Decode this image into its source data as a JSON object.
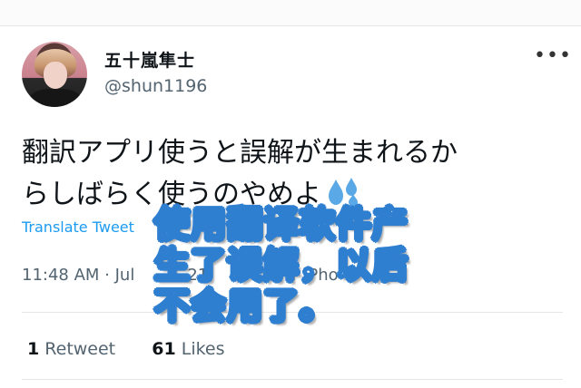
{
  "profile": {
    "display_name": "五十嵐隼士",
    "handle": "@shun1196"
  },
  "header": {
    "more_icon": "more-horizontal-icon",
    "more_glyph": "•••"
  },
  "tweet": {
    "text_line_1": "翻訳アプリ使うと誤解が生まれるか",
    "text_line_2": "らしばらく使うのやめよ",
    "emoji": "sweat-droplets-icon",
    "translate_label": "Translate Tweet",
    "timestamp": "11:48 AM · Jul",
    "timestamp_hidden_tail": "21",
    "source_partial": "r iPho"
  },
  "stats": {
    "retweets_count": "1",
    "retweets_label": "Retweet",
    "likes_count": "61",
    "likes_label": "Likes"
  },
  "overlay_caption": {
    "line_1": "使用翻译软件产",
    "line_2": "生了误解，以后",
    "line_3": "不会用了。",
    "stroke_color": "#2f7fd1"
  },
  "colors": {
    "link_blue": "#1d9bf0",
    "secondary_text": "#536471",
    "primary_text": "#0f1419"
  }
}
